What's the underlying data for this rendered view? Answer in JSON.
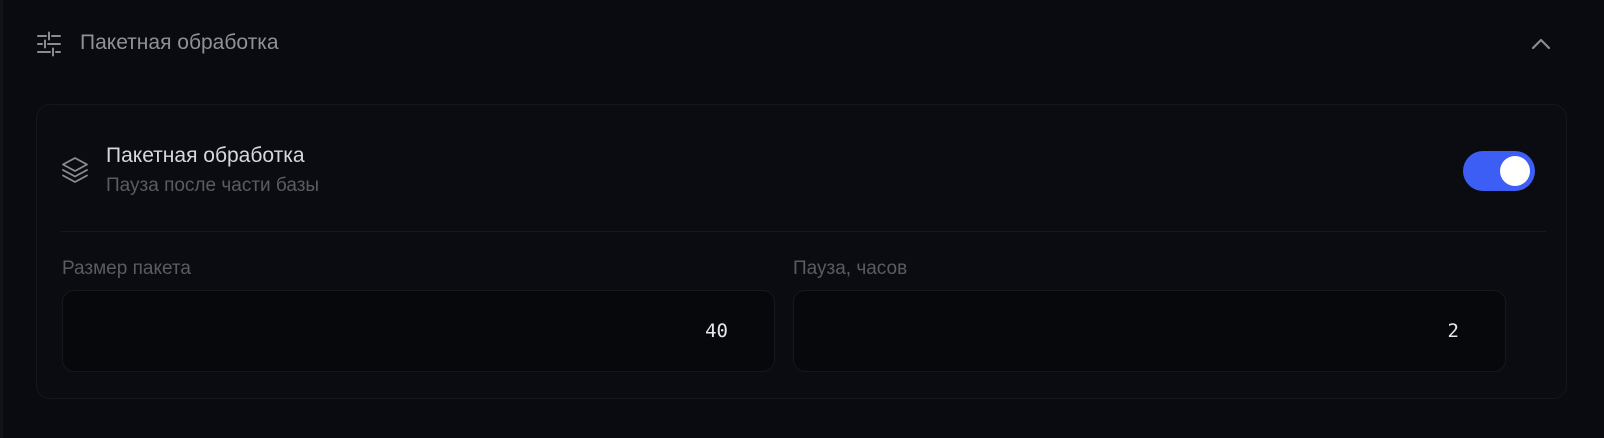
{
  "section": {
    "title": "Пакетная обработка",
    "header_icon": "sliders-icon",
    "collapse_icon": "chevron-up-icon",
    "expanded": true
  },
  "card": {
    "icon": "layers-icon",
    "title": "Пакетная обработка",
    "subtitle": "Пауза после части базы",
    "toggle_on": true
  },
  "fields": {
    "batch_size": {
      "label": "Размер пакета",
      "value": "40"
    },
    "pause_hours": {
      "label": "Пауза, часов",
      "value": "2"
    }
  },
  "colors": {
    "background": "#0a0b10",
    "accent": "#3d5ef5",
    "title_text": "#d7d8de",
    "muted_text": "#5a5b63"
  }
}
